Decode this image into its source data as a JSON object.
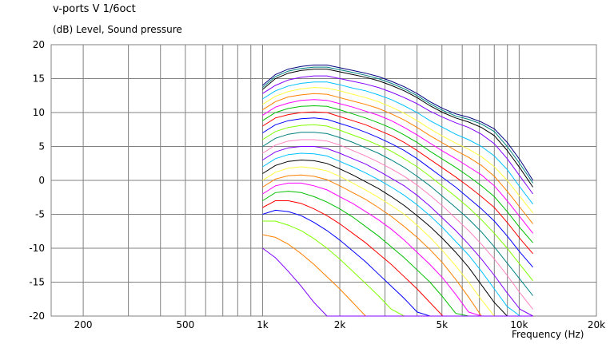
{
  "chart_data": {
    "type": "line",
    "title": "v-ports V 1/6oct",
    "ylabel": "(dB)  Level, Sound pressure",
    "xlabel": "Frequency  (Hz)",
    "xscale": "log",
    "xlim": [
      150,
      20000
    ],
    "ylim": [
      -20,
      20
    ],
    "x_ticks": [
      {
        "value": 200,
        "label": "200"
      },
      {
        "value": 500,
        "label": "500"
      },
      {
        "value": 1000,
        "label": "1k"
      },
      {
        "value": 2000,
        "label": "2k"
      },
      {
        "value": 5000,
        "label": "5k"
      },
      {
        "value": 10000,
        "label": "10k"
      },
      {
        "value": 20000,
        "label": "20k"
      }
    ],
    "y_ticks": [
      20,
      15,
      10,
      5,
      0,
      -5,
      -10,
      -15,
      -20
    ],
    "grid": true,
    "legend": "none",
    "x": [
      1000,
      1122,
      1260,
      1414,
      1587,
      1782,
      2000,
      2245,
      2520,
      2828,
      3175,
      3564,
      4000,
      4490,
      5040,
      5657,
      6350,
      7127,
      8000,
      8980,
      10079,
      11314
    ],
    "series": [
      {
        "color": "#000080",
        "values": [
          14.0,
          15.6,
          16.4,
          16.8,
          17.0,
          17.0,
          16.6,
          16.2,
          15.8,
          15.3,
          14.6,
          13.8,
          12.8,
          11.6,
          10.6,
          9.8,
          9.3,
          8.6,
          7.6,
          5.6,
          3.0,
          0.0
        ]
      },
      {
        "color": "#008080",
        "values": [
          13.7,
          15.3,
          16.1,
          16.5,
          16.7,
          16.7,
          16.3,
          15.9,
          15.5,
          15.0,
          14.3,
          13.5,
          12.5,
          11.3,
          10.3,
          9.5,
          9.0,
          8.3,
          7.2,
          5.0,
          2.4,
          -0.4
        ]
      },
      {
        "color": "#000000",
        "values": [
          13.4,
          15.0,
          15.8,
          16.2,
          16.4,
          16.4,
          16.0,
          15.6,
          15.2,
          14.7,
          14.0,
          13.2,
          12.2,
          11.0,
          10.0,
          9.2,
          8.6,
          7.8,
          6.6,
          4.4,
          1.8,
          -1.0
        ]
      },
      {
        "color": "#8000ff",
        "values": [
          12.8,
          14.0,
          14.8,
          15.2,
          15.4,
          15.4,
          15.0,
          14.6,
          14.2,
          13.7,
          13.0,
          12.2,
          11.3,
          10.2,
          9.3,
          8.5,
          7.8,
          6.8,
          5.4,
          3.2,
          0.6,
          -2.0
        ]
      },
      {
        "color": "#00c0ff",
        "values": [
          12.0,
          13.2,
          13.9,
          14.3,
          14.5,
          14.5,
          14.1,
          13.6,
          13.2,
          12.6,
          11.9,
          11.0,
          10.0,
          8.8,
          7.8,
          6.8,
          6.0,
          5.0,
          3.6,
          1.6,
          -1.0,
          -3.5
        ]
      },
      {
        "color": "#ffff40",
        "values": [
          11.2,
          12.4,
          13.1,
          13.5,
          13.7,
          13.6,
          13.2,
          12.7,
          12.2,
          11.6,
          10.8,
          9.9,
          8.8,
          7.6,
          6.5,
          5.5,
          4.6,
          3.5,
          2.0,
          0.0,
          -2.4,
          -4.8
        ]
      },
      {
        "color": "#ff8000",
        "values": [
          10.4,
          11.6,
          12.3,
          12.6,
          12.8,
          12.7,
          12.2,
          11.7,
          11.2,
          10.6,
          9.8,
          8.9,
          7.8,
          6.6,
          5.5,
          4.4,
          3.4,
          2.2,
          0.6,
          -1.6,
          -4.0,
          -6.4
        ]
      },
      {
        "color": "#ff00ff",
        "values": [
          9.6,
          10.8,
          11.4,
          11.8,
          11.9,
          11.8,
          11.3,
          10.8,
          10.2,
          9.6,
          8.8,
          7.8,
          6.7,
          5.5,
          4.3,
          3.2,
          2.0,
          0.8,
          -0.8,
          -3.0,
          -5.4,
          -7.8
        ]
      },
      {
        "color": "#00c000",
        "values": [
          8.8,
          10.0,
          10.6,
          10.9,
          11.0,
          10.9,
          10.4,
          9.8,
          9.2,
          8.5,
          7.7,
          6.7,
          5.6,
          4.3,
          3.1,
          1.9,
          0.6,
          -0.8,
          -2.4,
          -4.6,
          -7.0,
          -9.2
        ]
      },
      {
        "color": "#ff0000",
        "values": [
          8.0,
          9.2,
          9.7,
          10.0,
          10.1,
          10.0,
          9.4,
          8.8,
          8.2,
          7.4,
          6.6,
          5.6,
          4.4,
          3.1,
          1.8,
          0.5,
          -0.9,
          -2.4,
          -4.0,
          -6.2,
          -8.6,
          -10.8
        ]
      },
      {
        "color": "#0000ff",
        "values": [
          7.0,
          8.2,
          8.8,
          9.1,
          9.2,
          9.0,
          8.4,
          7.8,
          7.1,
          6.3,
          5.4,
          4.4,
          3.2,
          1.8,
          0.4,
          -1.0,
          -2.6,
          -4.2,
          -6.0,
          -8.2,
          -10.6,
          -12.8
        ]
      },
      {
        "color": "#80ff00",
        "values": [
          6.0,
          7.2,
          7.8,
          8.1,
          8.2,
          8.0,
          7.4,
          6.7,
          6.0,
          5.2,
          4.3,
          3.2,
          2.0,
          0.6,
          -0.9,
          -2.4,
          -4.0,
          -5.8,
          -7.8,
          -10.0,
          -12.4,
          -14.8
        ]
      },
      {
        "color": "#008080",
        "values": [
          5.0,
          6.2,
          6.8,
          7.1,
          7.1,
          6.9,
          6.3,
          5.6,
          4.8,
          4.0,
          3.0,
          1.9,
          0.6,
          -0.8,
          -2.4,
          -4.0,
          -5.7,
          -7.6,
          -9.8,
          -12.2,
          -14.6,
          -17.0
        ]
      },
      {
        "color": "#ff80c0",
        "values": [
          4.0,
          5.2,
          5.8,
          6.0,
          6.0,
          5.8,
          5.2,
          4.4,
          3.6,
          2.7,
          1.7,
          0.6,
          -0.7,
          -2.2,
          -3.8,
          -5.6,
          -7.4,
          -9.4,
          -11.6,
          -14.0,
          -16.6,
          -19.0
        ]
      },
      {
        "color": "#8000ff",
        "values": [
          3.0,
          4.2,
          4.8,
          5.0,
          5.0,
          4.7,
          4.0,
          3.2,
          2.4,
          1.4,
          0.3,
          -0.8,
          -2.2,
          -3.8,
          -5.6,
          -7.4,
          -9.4,
          -11.6,
          -14.0,
          -16.6,
          -19.0,
          -20.0
        ]
      },
      {
        "color": "#00c0ff",
        "values": [
          2.0,
          3.2,
          3.8,
          4.0,
          3.9,
          3.6,
          2.8,
          2.0,
          1.1,
          0.1,
          -1.0,
          -2.2,
          -3.6,
          -5.2,
          -7.0,
          -9.0,
          -11.0,
          -13.4,
          -16.0,
          -18.6,
          -20.0,
          -20.0
        ]
      },
      {
        "color": "#000000",
        "values": [
          1.0,
          2.2,
          2.8,
          3.0,
          2.9,
          2.5,
          1.7,
          0.8,
          -0.2,
          -1.2,
          -2.4,
          -3.7,
          -5.2,
          -6.8,
          -8.6,
          -10.6,
          -12.8,
          -15.4,
          -18.0,
          -20.0,
          -20.0,
          -20.0
        ]
      },
      {
        "color": "#ffff40",
        "values": [
          0.0,
          1.2,
          1.8,
          2.0,
          1.8,
          1.4,
          0.6,
          -0.4,
          -1.4,
          -2.5,
          -3.7,
          -5.0,
          -6.6,
          -8.4,
          -10.4,
          -12.6,
          -15.0,
          -17.6,
          -20.0,
          -20.0,
          -20.0,
          -20.0
        ]
      },
      {
        "color": "#ff8000",
        "values": [
          -1.0,
          0.2,
          0.7,
          0.8,
          0.6,
          0.1,
          -0.8,
          -1.8,
          -2.8,
          -4.0,
          -5.3,
          -6.8,
          -8.4,
          -10.2,
          -12.2,
          -14.6,
          -17.2,
          -20.0,
          -20.0,
          -20.0,
          -20.0,
          -20.0
        ]
      },
      {
        "color": "#ff00ff",
        "values": [
          -2.0,
          -0.8,
          -0.4,
          -0.4,
          -0.8,
          -1.4,
          -2.4,
          -3.4,
          -4.6,
          -5.8,
          -7.2,
          -8.8,
          -10.6,
          -12.4,
          -14.4,
          -16.8,
          -19.4,
          -20.0,
          -20.0,
          -20.0,
          -20.0,
          -20.0
        ]
      },
      {
        "color": "#00c000",
        "values": [
          -3.0,
          -1.8,
          -1.6,
          -1.8,
          -2.4,
          -3.2,
          -4.2,
          -5.4,
          -6.8,
          -8.2,
          -9.8,
          -11.4,
          -13.2,
          -15.0,
          -17.2,
          -19.6,
          -20.0,
          -20.0,
          -20.0,
          -20.0,
          -20.0,
          -20.0
        ]
      },
      {
        "color": "#ff0000",
        "values": [
          -4.0,
          -3.0,
          -3.0,
          -3.4,
          -4.2,
          -5.2,
          -6.4,
          -7.8,
          -9.2,
          -10.8,
          -12.4,
          -14.2,
          -16.0,
          -18.0,
          -20.0,
          -20.0,
          -20.0,
          -20.0,
          -20.0,
          -20.0,
          -20.0,
          -20.0
        ]
      },
      {
        "color": "#0000ff",
        "values": [
          -5.0,
          -4.4,
          -4.6,
          -5.2,
          -6.2,
          -7.4,
          -8.8,
          -10.4,
          -12.0,
          -13.8,
          -15.6,
          -17.4,
          -19.4,
          -20.0,
          -20.0,
          -20.0,
          -20.0,
          -20.0,
          -20.0,
          -20.0,
          -20.0,
          -20.0
        ]
      },
      {
        "color": "#80ff00",
        "values": [
          -6.0,
          -6.0,
          -6.6,
          -7.4,
          -8.6,
          -10.0,
          -11.6,
          -13.4,
          -15.2,
          -17.0,
          -19.0,
          -20.0,
          -20.0,
          -20.0,
          -20.0,
          -20.0,
          -20.0,
          -20.0,
          -20.0,
          -20.0,
          -20.0,
          -20.0
        ]
      },
      {
        "color": "#ff8000",
        "values": [
          -8.0,
          -8.4,
          -9.4,
          -10.8,
          -12.4,
          -14.2,
          -16.0,
          -18.0,
          -20.0,
          -20.0,
          -20.0,
          -20.0,
          -20.0,
          -20.0,
          -20.0,
          -20.0,
          -20.0,
          -20.0,
          -20.0,
          -20.0,
          -20.0,
          -20.0
        ]
      },
      {
        "color": "#8000ff",
        "values": [
          -10.0,
          -11.4,
          -13.4,
          -15.6,
          -18.0,
          -20.0,
          -20.0,
          -20.0,
          -20.0,
          -20.0,
          -20.0,
          -20.0,
          -20.0,
          -20.0,
          -20.0,
          -20.0,
          -20.0,
          -20.0,
          -20.0,
          -20.0,
          -20.0,
          -20.0
        ]
      }
    ]
  }
}
